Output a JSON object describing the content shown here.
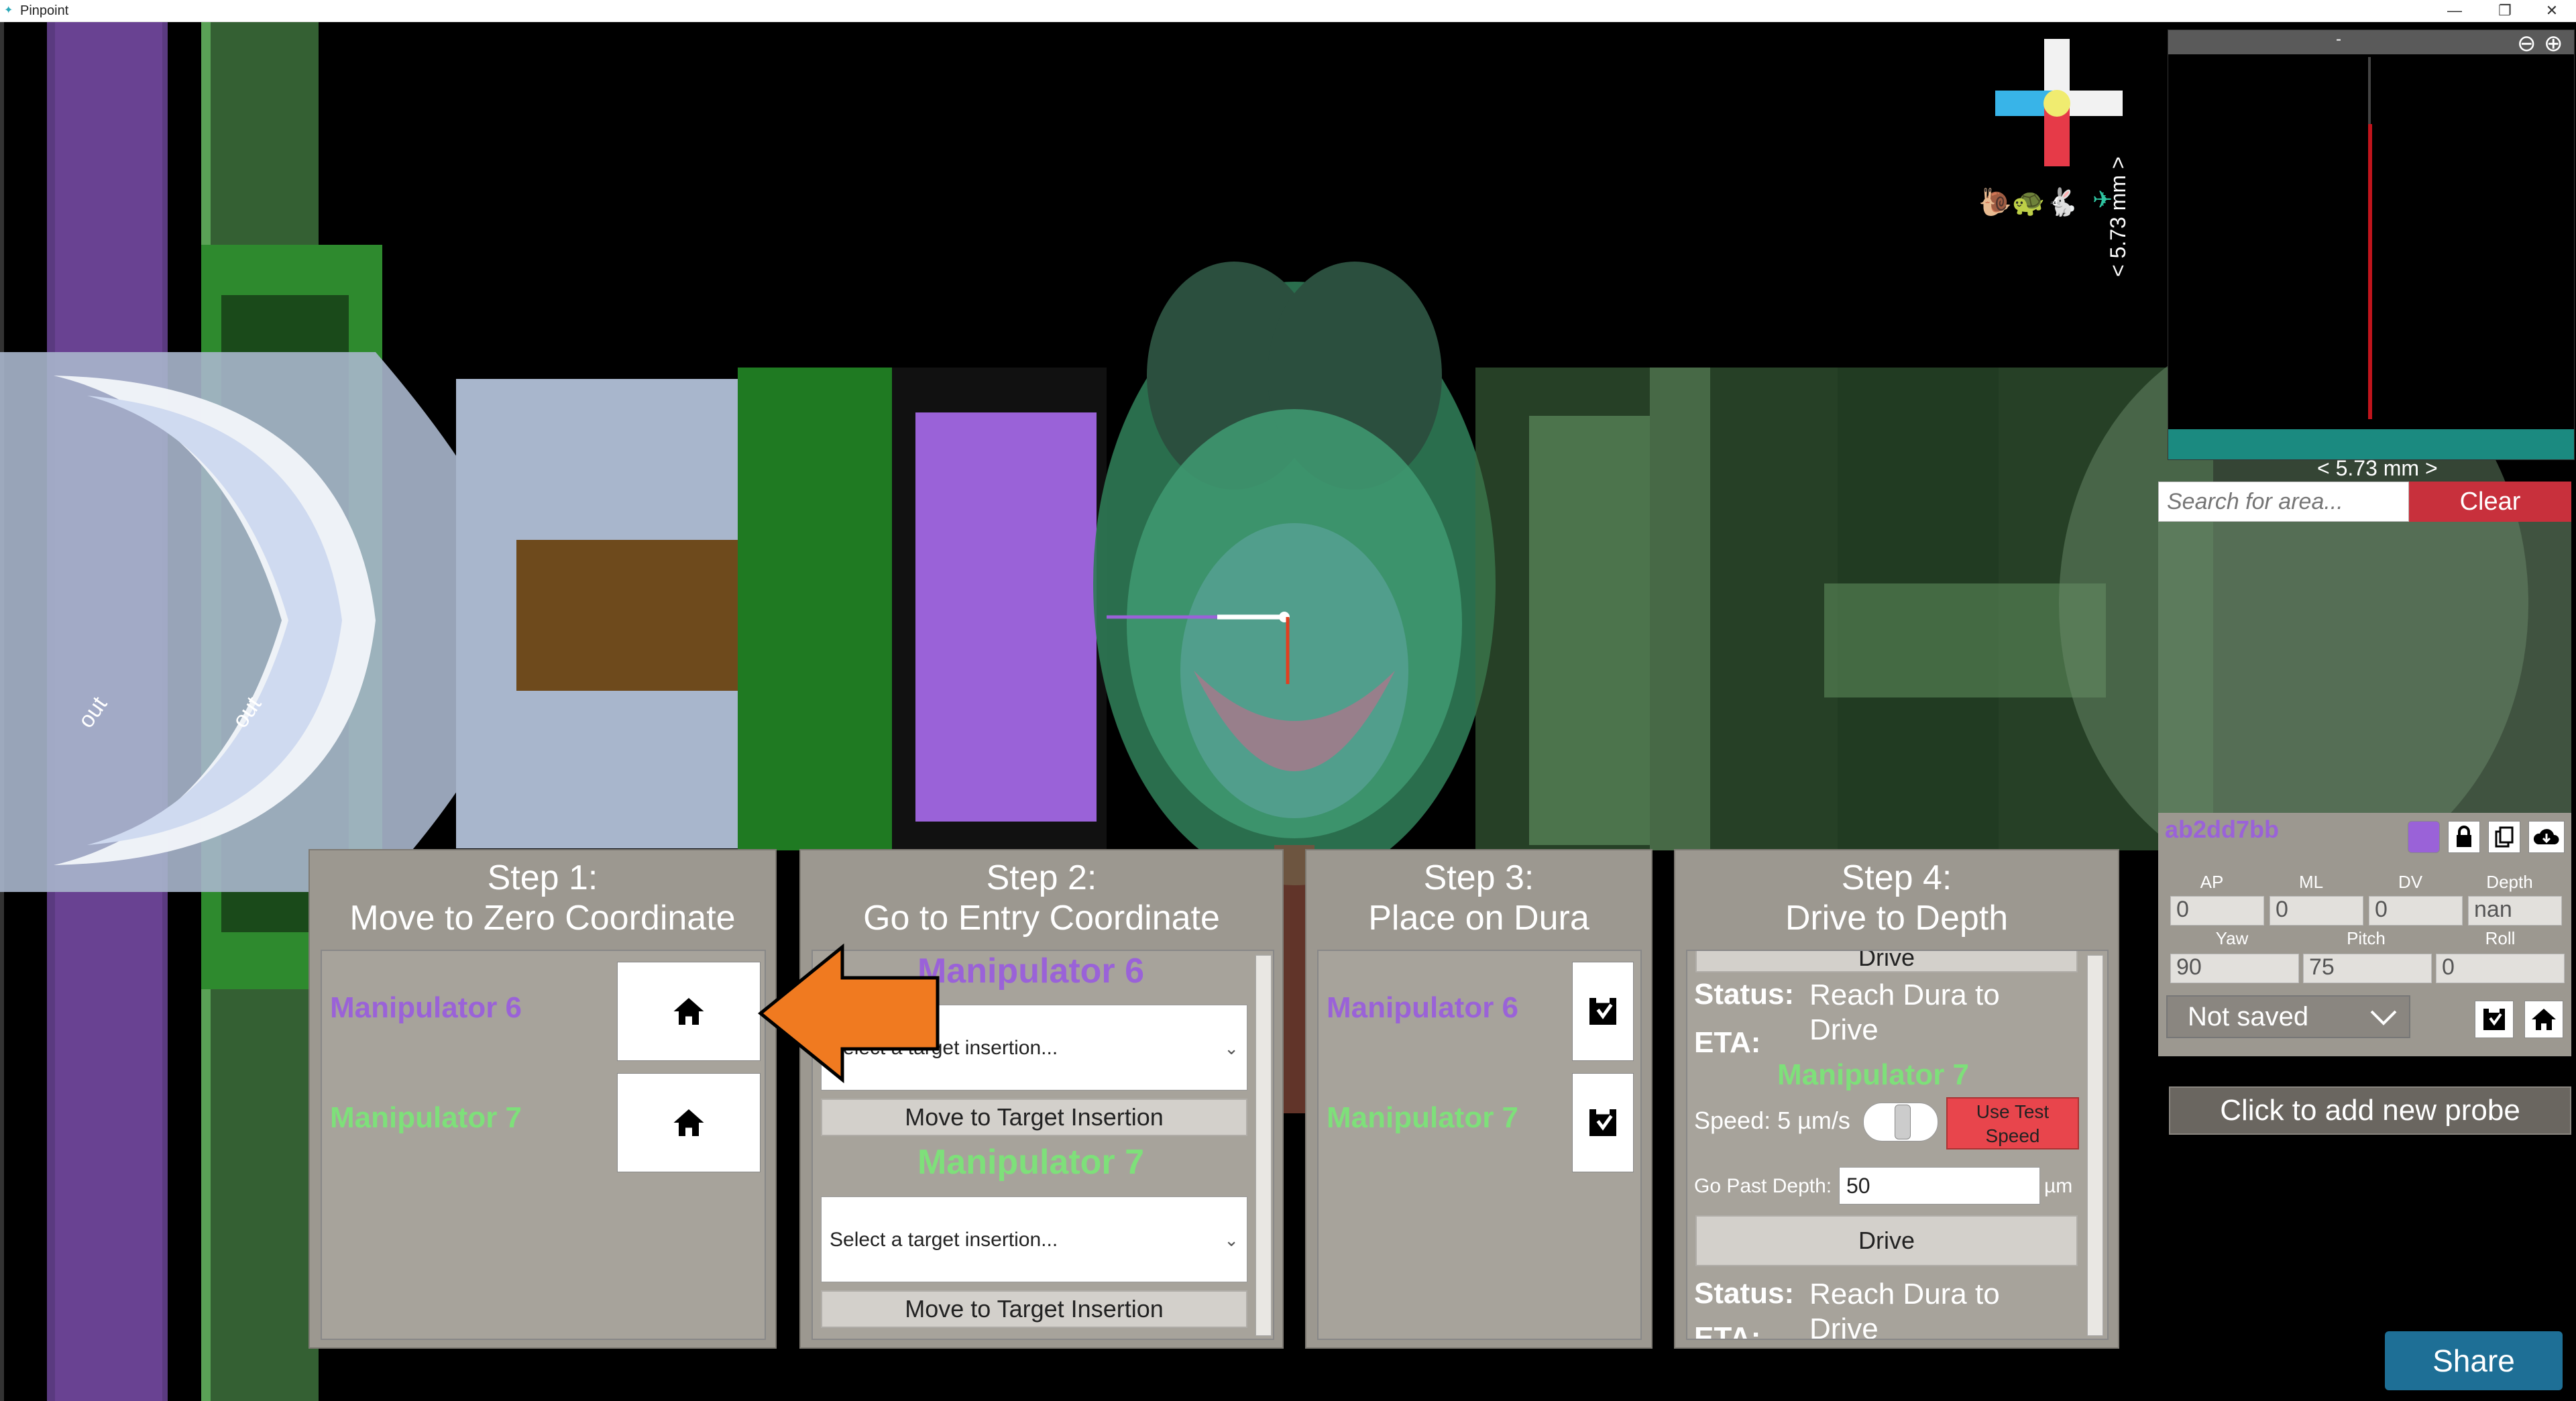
{
  "window": {
    "title": "Pinpoint",
    "minimize": "—",
    "restore": "❐",
    "close": "✕"
  },
  "scene": {
    "label_out_1": "out",
    "label_out_2": "out",
    "scale_vertical": "< 5.73 mm >",
    "scale_horizontal": "< 5.73 mm >"
  },
  "area_search": {
    "placeholder": "Search for area...",
    "clear_label": "Clear"
  },
  "probe_panel": {
    "probe_id": "ab2dd7bb",
    "headers": [
      "AP",
      "ML",
      "DV",
      "Depth"
    ],
    "values": [
      "0",
      "0",
      "0",
      "nan"
    ],
    "angle_headers": [
      "Yaw",
      "Pitch",
      "Roll"
    ],
    "angle_values": [
      "90",
      "75",
      "0"
    ],
    "save_state": "Not saved",
    "color": "#9a62d8"
  },
  "add_probe_label": "Click to add new probe",
  "share_label": "Share",
  "step1": {
    "title_line1": "Step 1:",
    "title_line2": "Move to Zero Coordinate",
    "manipulators": [
      "Manipulator 6",
      "Manipulator 7"
    ]
  },
  "step2": {
    "title_line1": "Step 2:",
    "title_line2": "Go to Entry Coordinate",
    "manipulator_6": "Manipulator 6",
    "manipulator_7": "Manipulator 7",
    "select_placeholder_6": "Select a target insertion...",
    "select_placeholder_7": "Select a target insertion...",
    "move_button_6": "Move to Target Insertion",
    "move_button_7": "Move to Target Insertion"
  },
  "step3": {
    "title_line1": "Step 3:",
    "title_line2": "Place on Dura",
    "manipulators": [
      "Manipulator 6",
      "Manipulator 7"
    ]
  },
  "step4": {
    "title_line1": "Step 4:",
    "title_line2": "Drive to Depth",
    "drive_top": "Drive",
    "status_label": "Status:",
    "status_value": "Reach Dura to Drive",
    "eta_label": "ETA:",
    "manipulator": "Manipulator 7",
    "speed_label": "Speed: 5 µm/s",
    "test_speed_label": "Use Test Speed",
    "go_past_label": "Go Past Depth:",
    "go_past_value": "50",
    "go_past_unit": "µm",
    "drive_button": "Drive",
    "status_label_2": "Status:",
    "status_value_2": "Reach Dura to Drive",
    "eta_label_2": "ETA:"
  },
  "colors": {
    "accent_purple": "#9a62d8",
    "accent_green": "#7ee07a",
    "clear_red": "#c8303c",
    "share_blue": "#1e6f96",
    "test_speed_red": "#e8454c"
  }
}
